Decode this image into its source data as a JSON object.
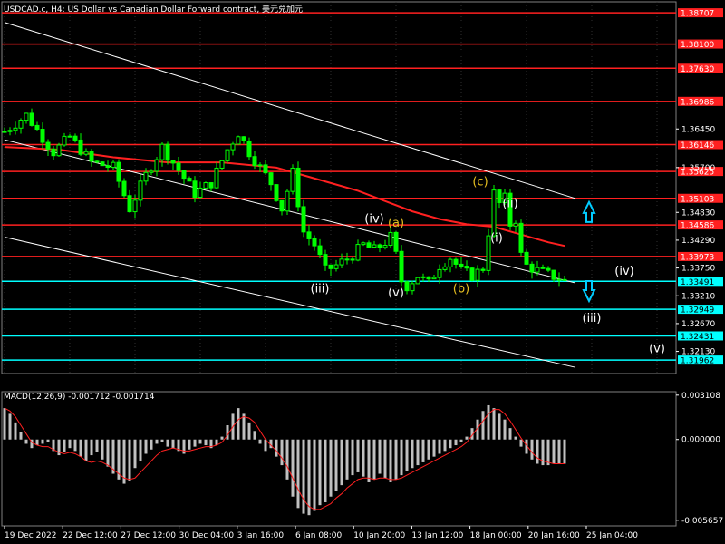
{
  "title": "USDCAD.c, H4:  US Dollar vs Canadian Dollar Forward contract, 美元兑加元",
  "macd_label": "MACD(12,26,9) -0.001712 -0.001714",
  "colors": {
    "background": "#000000",
    "candle": "#00ff00",
    "grid": "#303030",
    "axis_text": "#ffffff",
    "ma": "#ff2020",
    "channel": "#ffffff",
    "resistance": "#ff2020",
    "support": "#00ffff",
    "macd_hist": "#c0c0c0",
    "macd_signal": "#ff2020",
    "wave_white": "#ffffff",
    "wave_yellow": "#e8c020",
    "arrow": "#00ccff"
  },
  "chart_data": [
    {
      "type": "candlestick",
      "symbol": "USDCAD.c",
      "timeframe": "H4",
      "ylim": [
        1.317,
        1.3892
      ],
      "price_ticks": [
        "1.36450",
        "1.35700",
        "1.34830",
        "1.34290",
        "1.33750",
        "1.33210",
        "1.32670",
        "1.32130"
      ],
      "x_labels": [
        "19 Dec 2022",
        "22 Dec 12:00",
        "27 Dec 12:00",
        "30 Dec 04:00",
        "3 Jan 16:00",
        "6 Jan 08:00",
        "10 Jan 20:00",
        "13 Jan 12:00",
        "18 Jan 00:00",
        "20 Jan 16:00",
        "25 Jan 04:00"
      ],
      "price_path": [
        [
          0,
          1.364
        ],
        [
          4,
          1.3672
        ],
        [
          9,
          1.36
        ],
        [
          12,
          1.363
        ],
        [
          16,
          1.358
        ],
        [
          20,
          1.357
        ],
        [
          23,
          1.349
        ],
        [
          26,
          1.3555
        ],
        [
          29,
          1.361
        ],
        [
          32,
          1.3565
        ],
        [
          35,
          1.352
        ],
        [
          38,
          1.354
        ],
        [
          41,
          1.3605
        ],
        [
          43,
          1.3638
        ],
        [
          45,
          1.36
        ],
        [
          47,
          1.357
        ],
        [
          49,
          1.354
        ],
        [
          51,
          1.349
        ],
        [
          53,
          1.356
        ],
        [
          55,
          1.3445
        ],
        [
          57,
          1.342
        ],
        [
          59,
          1.337
        ],
        [
          61,
          1.338
        ],
        [
          64,
          1.34
        ],
        [
          66,
          1.342
        ],
        [
          68,
          1.341
        ],
        [
          70,
          1.3425
        ],
        [
          71,
          1.3435
        ],
        [
          72,
          1.34
        ],
        [
          73,
          1.335
        ],
        [
          74,
          1.334
        ],
        [
          76,
          1.336
        ],
        [
          78,
          1.3345
        ],
        [
          80,
          1.338
        ],
        [
          82,
          1.3395
        ],
        [
          84,
          1.337
        ],
        [
          86,
          1.336
        ],
        [
          88,
          1.3375
        ],
        [
          89,
          1.3445
        ],
        [
          90,
          1.352
        ],
        [
          91,
          1.35
        ],
        [
          92,
          1.351
        ],
        [
          93,
          1.346
        ],
        [
          94,
          1.347
        ],
        [
          95,
          1.34
        ],
        [
          96,
          1.338
        ],
        [
          98,
          1.337
        ],
        [
          100,
          1.3362
        ],
        [
          102,
          1.3355
        ],
        [
          103,
          1.335
        ]
      ],
      "moving_average": [
        [
          0,
          1.361
        ],
        [
          10,
          1.3605
        ],
        [
          20,
          1.359
        ],
        [
          30,
          1.358
        ],
        [
          40,
          1.358
        ],
        [
          50,
          1.357
        ],
        [
          55,
          1.3555
        ],
        [
          60,
          1.354
        ],
        [
          65,
          1.3525
        ],
        [
          70,
          1.3505
        ],
        [
          75,
          1.3485
        ],
        [
          80,
          1.347
        ],
        [
          85,
          1.346
        ],
        [
          90,
          1.3455
        ],
        [
          95,
          1.344
        ],
        [
          100,
          1.3425
        ],
        [
          103,
          1.3418
        ]
      ],
      "horizontal_levels": [
        {
          "price": "1.38707",
          "kind": "resistance"
        },
        {
          "price": "1.38100",
          "kind": "resistance"
        },
        {
          "price": "1.37630",
          "kind": "resistance"
        },
        {
          "price": "1.36986",
          "kind": "resistance"
        },
        {
          "price": "1.36146",
          "kind": "resistance"
        },
        {
          "price": "1.35625",
          "kind": "resistance"
        },
        {
          "price": "1.35103",
          "kind": "resistance"
        },
        {
          "price": "1.34586",
          "kind": "resistance"
        },
        {
          "price": "1.33973",
          "kind": "resistance"
        },
        {
          "price": "1.33491",
          "kind": "support"
        },
        {
          "price": "1.32949",
          "kind": "support"
        },
        {
          "price": "1.32431",
          "kind": "support"
        },
        {
          "price": "1.31962",
          "kind": "support"
        }
      ],
      "channels": [
        {
          "start": [
            0,
            1.3852
          ],
          "end": [
            105,
            1.351
          ]
        },
        {
          "start": [
            0,
            1.3624
          ],
          "end": [
            105,
            1.3346
          ]
        },
        {
          "start": [
            0,
            1.3435
          ],
          "end": [
            105,
            1.3182
          ]
        }
      ],
      "wave_labels": [
        {
          "text": "(iii)",
          "price": 1.3328,
          "bar": 58,
          "color": "white"
        },
        {
          "text": "(iv)",
          "price": 1.3463,
          "bar": 68,
          "color": "white"
        },
        {
          "text": "(a)",
          "price": 1.3455,
          "bar": 72,
          "color": "yellow"
        },
        {
          "text": "(v)",
          "price": 1.332,
          "bar": 72,
          "color": "white"
        },
        {
          "text": "(b)",
          "price": 1.3328,
          "bar": 84,
          "color": "yellow"
        },
        {
          "text": "(c)",
          "price": 1.3535,
          "bar": 87.5,
          "color": "yellow"
        },
        {
          "text": "(ii)",
          "price": 1.3493,
          "bar": 93,
          "color": "white"
        },
        {
          "text": "(i)",
          "price": 1.3426,
          "bar": 90.5,
          "color": "white"
        },
        {
          "text": "(iv)",
          "price": 1.3362,
          "bar": 114,
          "color": "white"
        },
        {
          "text": "(iii)",
          "price": 1.327,
          "bar": 108,
          "color": "white"
        },
        {
          "text": "(v)",
          "price": 1.3211,
          "bar": 120,
          "color": "white"
        }
      ],
      "arrows": [
        {
          "direction": "up",
          "bar": 107.5,
          "price": 1.3482
        },
        {
          "direction": "down",
          "bar": 107.5,
          "price": 1.3332
        }
      ]
    },
    {
      "type": "bar",
      "name": "MACD(12,26,9)",
      "ylim": [
        -0.00605,
        0.00335
      ],
      "y_ticks": [
        "0.003108",
        "0.000000",
        "-0.005657"
      ],
      "macd_last": -0.001712,
      "signal_last": -0.001714,
      "histogram": [
        0.0022,
        0.0018,
        0.0012,
        0.0005,
        -0.0003,
        -0.0006,
        -0.0004,
        -0.0003,
        -0.0002,
        -0.0008,
        -0.0011,
        -0.0009,
        -0.0006,
        -0.0008,
        -0.0012,
        -0.0015,
        -0.0011,
        -0.0009,
        -0.0014,
        -0.0019,
        -0.0024,
        -0.0028,
        -0.0031,
        -0.0029,
        -0.002,
        -0.0015,
        -0.001,
        -0.0007,
        -0.0003,
        -0.0002,
        -0.0005,
        -0.0006,
        -0.0008,
        -0.001,
        -0.0007,
        -0.0005,
        -0.0003,
        -0.0004,
        -0.0006,
        -0.0004,
        0.0002,
        0.001,
        0.0018,
        0.0022,
        0.0018,
        0.0012,
        0.0006,
        -0.0003,
        -0.0008,
        -0.0006,
        -0.0012,
        -0.0018,
        -0.0028,
        -0.004,
        -0.0048,
        -0.0052,
        -0.0053,
        -0.005,
        -0.0046,
        -0.0044,
        -0.004,
        -0.0036,
        -0.0032,
        -0.0028,
        -0.0025,
        -0.0023,
        -0.0026,
        -0.003,
        -0.0028,
        -0.0024,
        -0.0027,
        -0.003,
        -0.0028,
        -0.0025,
        -0.0022,
        -0.002,
        -0.0018,
        -0.0016,
        -0.0014,
        -0.0012,
        -0.001,
        -0.0008,
        -0.0006,
        -0.0004,
        -0.0002,
        0.0002,
        0.0008,
        0.0014,
        0.002,
        0.0024,
        0.0022,
        0.0018,
        0.0014,
        0.0008,
        0.0002,
        -0.0005,
        -0.001,
        -0.0014,
        -0.0017,
        -0.0018,
        -0.0018,
        -0.0017,
        -0.0017,
        -0.0017
      ],
      "signal": [
        0.0022,
        0.002,
        0.0016,
        0.001,
        0.0004,
        -0.0002,
        -0.0004,
        -0.0005,
        -0.0005,
        -0.0007,
        -0.0009,
        -0.001,
        -0.0009,
        -0.001,
        -0.0012,
        -0.0015,
        -0.0016,
        -0.0015,
        -0.0016,
        -0.0018,
        -0.0021,
        -0.0024,
        -0.0027,
        -0.0028,
        -0.0027,
        -0.0023,
        -0.0019,
        -0.0015,
        -0.0011,
        -0.0008,
        -0.0007,
        -0.0006,
        -0.0007,
        -0.0008,
        -0.0008,
        -0.0007,
        -0.0006,
        -0.0005,
        -0.0005,
        -0.0004,
        -0.0002,
        0.0003,
        0.0009,
        0.0014,
        0.0016,
        0.0015,
        0.0012,
        0.0006,
        0.0,
        -0.0004,
        -0.0008,
        -0.0013,
        -0.0019,
        -0.0027,
        -0.0035,
        -0.0042,
        -0.0047,
        -0.0049,
        -0.0049,
        -0.0047,
        -0.0045,
        -0.0041,
        -0.0038,
        -0.0034,
        -0.0031,
        -0.0028,
        -0.0027,
        -0.0027,
        -0.0028,
        -0.0027,
        -0.0027,
        -0.0028,
        -0.0028,
        -0.0027,
        -0.0025,
        -0.0023,
        -0.0021,
        -0.0019,
        -0.0017,
        -0.0015,
        -0.0013,
        -0.0011,
        -0.0009,
        -0.0007,
        -0.0005,
        -0.0002,
        0.0003,
        0.0008,
        0.0013,
        0.0018,
        0.0021,
        0.0021,
        0.0018,
        0.0013,
        0.0007,
        0.0001,
        -0.0004,
        -0.0009,
        -0.0013,
        -0.0015,
        -0.0016,
        -0.0017,
        -0.0017,
        -0.0017
      ]
    }
  ]
}
